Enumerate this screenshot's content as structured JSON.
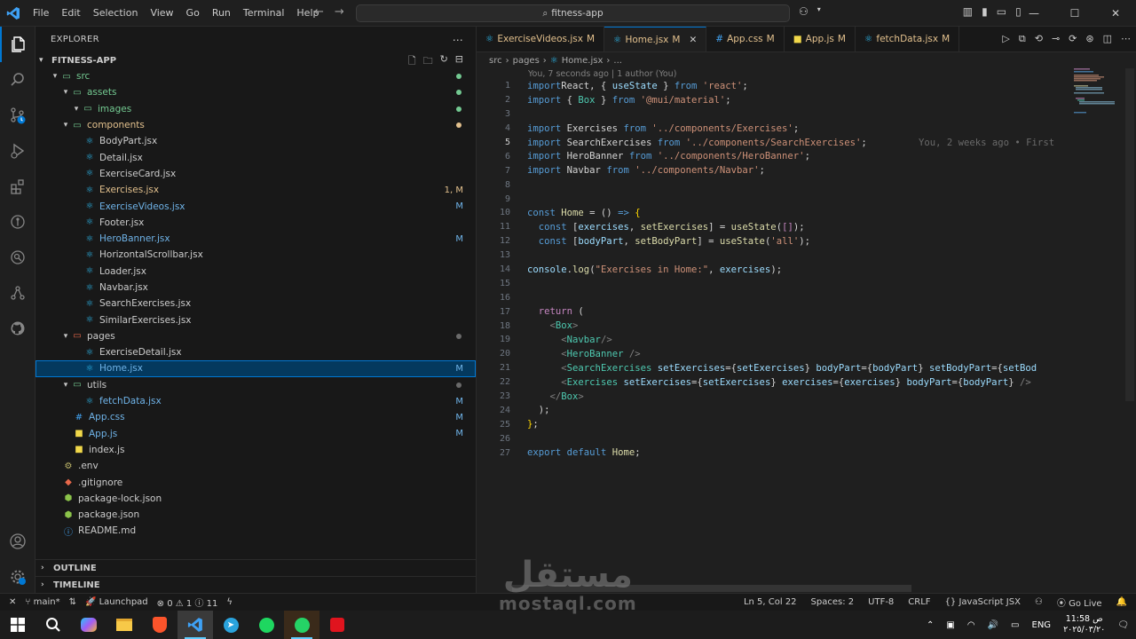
{
  "menu": [
    "File",
    "Edit",
    "Selection",
    "View",
    "Go",
    "Run",
    "Terminal",
    "Help"
  ],
  "search": {
    "text": "fitness-app"
  },
  "sidebar": {
    "title": "EXPLORER",
    "project": "FITNESS-APP",
    "tree": [
      {
        "label": "src",
        "kind": "folder-open",
        "depth": 0,
        "color": "#73c991",
        "dot": "#73c991"
      },
      {
        "label": "assets",
        "kind": "folder-open",
        "depth": 1,
        "color": "#73c991",
        "dot": "#73c991"
      },
      {
        "label": "images",
        "kind": "folder-open",
        "depth": 2,
        "color": "#73c991",
        "dot": "#73c991"
      },
      {
        "label": "components",
        "kind": "folder-open",
        "depth": 1,
        "color": "#e2c08d",
        "dot": "#e2c08d"
      },
      {
        "label": "BodyPart.jsx",
        "kind": "react",
        "depth": 2,
        "color": "#cccccc"
      },
      {
        "label": "Detail.jsx",
        "kind": "react",
        "depth": 2,
        "color": "#cccccc"
      },
      {
        "label": "ExerciseCard.jsx",
        "kind": "react",
        "depth": 2,
        "color": "#cccccc"
      },
      {
        "label": "Exercises.jsx",
        "kind": "react",
        "depth": 2,
        "color": "#e2c08d",
        "badge": "1, M",
        "badgeColor": "#e2c08d"
      },
      {
        "label": "ExerciseVideos.jsx",
        "kind": "react",
        "depth": 2,
        "color": "#6fb3e8",
        "badge": "M",
        "badgeColor": "#6fb3e8"
      },
      {
        "label": "Footer.jsx",
        "kind": "react",
        "depth": 2,
        "color": "#cccccc"
      },
      {
        "label": "HeroBanner.jsx",
        "kind": "react",
        "depth": 2,
        "color": "#6fb3e8",
        "badge": "M",
        "badgeColor": "#6fb3e8"
      },
      {
        "label": "HorizontalScrollbar.jsx",
        "kind": "react",
        "depth": 2,
        "color": "#cccccc"
      },
      {
        "label": "Loader.jsx",
        "kind": "react",
        "depth": 2,
        "color": "#cccccc"
      },
      {
        "label": "Navbar.jsx",
        "kind": "react",
        "depth": 2,
        "color": "#cccccc"
      },
      {
        "label": "SearchExercises.jsx",
        "kind": "react",
        "depth": 2,
        "color": "#cccccc"
      },
      {
        "label": "SimilarExercises.jsx",
        "kind": "react",
        "depth": 2,
        "color": "#cccccc"
      },
      {
        "label": "pages",
        "kind": "folder-red",
        "depth": 1,
        "color": "#cccccc",
        "dot": "#6a6a6a"
      },
      {
        "label": "ExerciseDetail.jsx",
        "kind": "react",
        "depth": 2,
        "color": "#cccccc"
      },
      {
        "label": "Home.jsx",
        "kind": "react",
        "depth": 2,
        "color": "#6fb3e8",
        "badge": "M",
        "badgeColor": "#6fb3e8",
        "selected": true
      },
      {
        "label": "utils",
        "kind": "folder-open",
        "depth": 1,
        "color": "#cccccc",
        "dot": "#6a6a6a"
      },
      {
        "label": "fetchData.jsx",
        "kind": "react",
        "depth": 2,
        "color": "#6fb3e8",
        "badge": "M",
        "badgeColor": "#6fb3e8"
      },
      {
        "label": "App.css",
        "kind": "css",
        "depth": 1,
        "color": "#6fb3e8",
        "badge": "M",
        "badgeColor": "#6fb3e8"
      },
      {
        "label": "App.js",
        "kind": "js",
        "depth": 1,
        "color": "#6fb3e8",
        "badge": "M",
        "badgeColor": "#6fb3e8"
      },
      {
        "label": "index.js",
        "kind": "js",
        "depth": 1,
        "color": "#cccccc"
      },
      {
        "label": ".env",
        "kind": "env",
        "depth": 0,
        "color": "#cccccc"
      },
      {
        "label": ".gitignore",
        "kind": "git",
        "depth": 0,
        "color": "#cccccc"
      },
      {
        "label": "package-lock.json",
        "kind": "npm",
        "depth": 0,
        "color": "#cccccc"
      },
      {
        "label": "package.json",
        "kind": "npm",
        "depth": 0,
        "color": "#cccccc"
      },
      {
        "label": "README.md",
        "kind": "info",
        "depth": 0,
        "color": "#cccccc"
      }
    ],
    "sections": [
      "OUTLINE",
      "TIMELINE"
    ]
  },
  "tabs": [
    {
      "label": "ExerciseVideos.jsx",
      "badge": "M",
      "icon": "react"
    },
    {
      "label": "Home.jsx",
      "badge": "M",
      "icon": "react",
      "active": true
    },
    {
      "label": "App.css",
      "badge": "M",
      "icon": "css"
    },
    {
      "label": "App.js",
      "badge": "M",
      "icon": "js"
    },
    {
      "label": "fetchData.jsx",
      "badge": "M",
      "icon": "react"
    }
  ],
  "breadcrumb": [
    "src",
    "pages",
    "Home.jsx",
    "..."
  ],
  "blame": "You, 7 seconds ago | 1 author (You)",
  "ghost_blame": "You, 2 weeks ago • First",
  "current_line": 5,
  "code": [
    [
      [
        "kb",
        "import"
      ],
      [
        "",
        "React, { "
      ],
      [
        "v",
        "useState"
      ],
      [
        "",
        " } "
      ],
      [
        "kb",
        "from"
      ],
      [
        "",
        " "
      ],
      [
        "s",
        "'react'"
      ],
      [
        "",
        ";"
      ]
    ],
    [
      [
        "kb",
        "import"
      ],
      [
        "",
        " { "
      ],
      [
        "c",
        "Box"
      ],
      [
        "",
        " } "
      ],
      [
        "kb",
        "from"
      ],
      [
        "",
        " "
      ],
      [
        "s",
        "'@mui/material'"
      ],
      [
        "",
        ";"
      ]
    ],
    [],
    [
      [
        "kb",
        "import"
      ],
      [
        "",
        " Exercises "
      ],
      [
        "kb",
        "from"
      ],
      [
        "",
        " "
      ],
      [
        "s",
        "'../components/Exercises'"
      ],
      [
        "",
        ";"
      ]
    ],
    [
      [
        "kb",
        "import"
      ],
      [
        "",
        " SearchExercises "
      ],
      [
        "kb",
        "from"
      ],
      [
        "",
        " "
      ],
      [
        "s",
        "'../components/SearchExercises'"
      ],
      [
        "",
        ";"
      ]
    ],
    [
      [
        "kb",
        "import"
      ],
      [
        "",
        " HeroBanner "
      ],
      [
        "kb",
        "from"
      ],
      [
        "",
        " "
      ],
      [
        "s",
        "'../components/HeroBanner'"
      ],
      [
        "",
        ";"
      ]
    ],
    [
      [
        "kb",
        "import"
      ],
      [
        "",
        " Navbar "
      ],
      [
        "kb",
        "from"
      ],
      [
        "",
        " "
      ],
      [
        "s",
        "'../components/Navbar'"
      ],
      [
        "",
        ";"
      ]
    ],
    [],
    [],
    [
      [
        "kb",
        "const"
      ],
      [
        "",
        " "
      ],
      [
        "f",
        "Home"
      ],
      [
        "",
        " = () "
      ],
      [
        "kb",
        "=>"
      ],
      [
        "",
        " "
      ],
      [
        "p",
        "{"
      ]
    ],
    [
      [
        "",
        ""
      ],
      [
        "kb",
        "const"
      ],
      [
        "",
        " ["
      ],
      [
        "v",
        "exercises"
      ],
      [
        "",
        ", "
      ],
      [
        "f",
        "setExercises"
      ],
      [
        "",
        "] = "
      ],
      [
        "f",
        "useState"
      ],
      [
        "",
        "("
      ],
      [
        "k",
        "[]"
      ],
      [
        "",
        ");"
      ]
    ],
    [
      [
        "",
        ""
      ],
      [
        "kb",
        "const"
      ],
      [
        "",
        " ["
      ],
      [
        "v",
        "bodyPart"
      ],
      [
        "",
        ", "
      ],
      [
        "f",
        "setBodyPart"
      ],
      [
        "",
        "] = "
      ],
      [
        "f",
        "useState"
      ],
      [
        "",
        "("
      ],
      [
        "s",
        "'all'"
      ],
      [
        "",
        ");"
      ]
    ],
    [],
    [
      [
        "v",
        "console"
      ],
      [
        ".",
        ""
      ],
      [
        "f",
        "log"
      ],
      [
        "",
        "("
      ],
      [
        "s",
        "\"Exercises in Home:\""
      ],
      [
        "",
        ", "
      ],
      [
        "v",
        "exercises"
      ],
      [
        "",
        ");"
      ]
    ],
    [],
    [],
    [
      [
        "",
        ""
      ],
      [
        "k",
        "return"
      ],
      [
        "",
        " ("
      ]
    ],
    [
      [
        "",
        ""
      ],
      [
        "g",
        "<"
      ],
      [
        "t",
        "Box"
      ],
      [
        "g",
        ">"
      ]
    ],
    [
      [
        "",
        ""
      ],
      [
        "g",
        "<"
      ],
      [
        "t",
        "Navbar"
      ],
      [
        "g",
        "/>"
      ]
    ],
    [
      [
        "",
        ""
      ],
      [
        "g",
        "<"
      ],
      [
        "t",
        "HeroBanner"
      ],
      [
        "g",
        " />"
      ]
    ],
    [
      [
        "",
        ""
      ],
      [
        "g",
        "<"
      ],
      [
        "t",
        "SearchExercises"
      ],
      [
        "",
        " "
      ],
      [
        "v",
        "setExercises"
      ],
      [
        "",
        "={"
      ],
      [
        "v",
        "setExercises"
      ],
      [
        "",
        "} "
      ],
      [
        "v",
        "bodyPart"
      ],
      [
        "",
        "={"
      ],
      [
        "v",
        "bodyPart"
      ],
      [
        "",
        "} "
      ],
      [
        "v",
        "setBodyPart"
      ],
      [
        "",
        "={"
      ],
      [
        "v",
        "setBod"
      ]
    ],
    [
      [
        "",
        ""
      ],
      [
        "g",
        "<"
      ],
      [
        "t",
        "Exercises"
      ],
      [
        "",
        " "
      ],
      [
        "v",
        "setExercises"
      ],
      [
        "",
        "={"
      ],
      [
        "v",
        "setExercises"
      ],
      [
        "",
        "} "
      ],
      [
        "v",
        "exercises"
      ],
      [
        "",
        "={"
      ],
      [
        "v",
        "exercises"
      ],
      [
        "",
        "} "
      ],
      [
        "v",
        "bodyPart"
      ],
      [
        "",
        "={"
      ],
      [
        "v",
        "bodyPart"
      ],
      [
        "",
        "} "
      ],
      [
        "g",
        "/>"
      ]
    ],
    [
      [
        "",
        ""
      ],
      [
        "g",
        "</"
      ],
      [
        "t",
        "Box"
      ],
      [
        "g",
        ">"
      ]
    ],
    [
      [
        "",
        ""
      ],
      [
        "",
        ");"
      ]
    ],
    [
      [
        "p",
        "}"
      ],
      [
        "",
        ";"
      ]
    ],
    [],
    [
      [
        "kb",
        "export"
      ],
      [
        "",
        " "
      ],
      [
        "kb",
        "default"
      ],
      [
        "",
        " "
      ],
      [
        "f",
        "Home"
      ],
      [
        "",
        ";"
      ]
    ]
  ],
  "indents": [
    0,
    0,
    0,
    0,
    0,
    0,
    0,
    0,
    0,
    0,
    1,
    1,
    0,
    0,
    0,
    0,
    1,
    2,
    3,
    3,
    3,
    3,
    2,
    1,
    0,
    0,
    0
  ],
  "statusbar": {
    "branch": "main*",
    "launchpad": "Launchpad",
    "problems": "0",
    "warnings": "1",
    "info": "11",
    "position": "Ln 5, Col 22",
    "spaces": "Spaces: 2",
    "encoding": "UTF-8",
    "eol": "CRLF",
    "language": "JavaScript JSX",
    "golive": "Go Live"
  },
  "taskbar": {
    "lang": "ENG",
    "time": "11:58 ص",
    "date": "٢٠٢٥/٠٣/٢٠"
  },
  "watermark": {
    "arabic": "مستقل",
    "latin": "mostaql.com"
  }
}
